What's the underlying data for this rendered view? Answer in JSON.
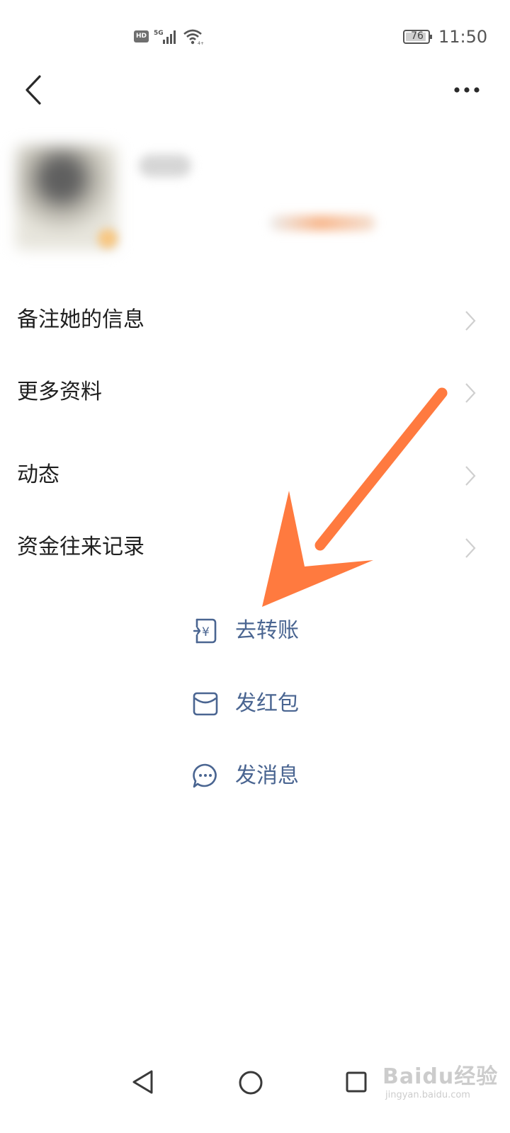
{
  "status_bar": {
    "hd_badge": "HD",
    "network_label": "5G",
    "battery_level": "76",
    "time": "11:50"
  },
  "header": {
    "back_icon": "chevron-left-icon",
    "more_icon": "more-horizontal-icon"
  },
  "menu": {
    "items": [
      {
        "label": "备注她的信息"
      },
      {
        "label": "更多资料"
      },
      {
        "label": "动态"
      },
      {
        "label": "资金往来记录"
      }
    ]
  },
  "actions": {
    "items": [
      {
        "label": "去转账",
        "icon": "transfer-yen-icon"
      },
      {
        "label": "发红包",
        "icon": "red-envelope-icon"
      },
      {
        "label": "发消息",
        "icon": "chat-bubble-icon"
      }
    ]
  },
  "annotation": {
    "arrow_color": "#ff7a3f"
  },
  "colors": {
    "action_text": "#4a6591",
    "action_icon": "#4a6591"
  },
  "watermark": {
    "brand": "Baidu经验",
    "url": "jingyan.baidu.com"
  }
}
